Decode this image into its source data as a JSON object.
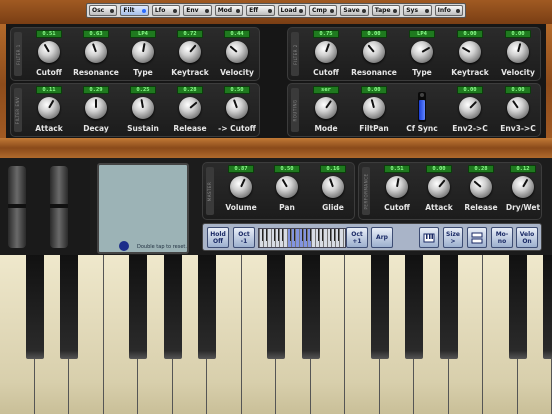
{
  "menu": [
    {
      "label": "Osc",
      "active": false
    },
    {
      "label": "Filt",
      "active": true
    },
    {
      "label": "Lfo",
      "active": false
    },
    {
      "label": "Env",
      "active": false
    },
    {
      "label": "Mod",
      "active": false
    },
    {
      "label": "Eff",
      "active": false
    },
    {
      "label": "Load",
      "active": false
    },
    {
      "label": "Cmp",
      "active": false
    },
    {
      "label": "Save",
      "active": false
    },
    {
      "label": "Tape",
      "active": false
    },
    {
      "label": "Sys",
      "active": false
    },
    {
      "label": "Info",
      "active": false
    }
  ],
  "filter1": {
    "label": "FILTER 1",
    "knobs": [
      {
        "name": "Cutoff",
        "value": "0.51"
      },
      {
        "name": "Resonance",
        "value": "0.63"
      },
      {
        "name": "Type",
        "value": "LP4"
      },
      {
        "name": "Keytrack",
        "value": "0.72"
      },
      {
        "name": "Velocity",
        "value": "0.44"
      }
    ]
  },
  "env1": {
    "label": "FILTER ENV",
    "knobs": [
      {
        "name": "Attack",
        "value": "0.11"
      },
      {
        "name": "Decay",
        "value": "0.29"
      },
      {
        "name": "Sustain",
        "value": "0.25"
      },
      {
        "name": "Release",
        "value": "0.28"
      },
      {
        "name": "-> Cutoff",
        "value": "0.50"
      }
    ]
  },
  "filter2": {
    "label": "FILTER 2",
    "knobs": [
      {
        "name": "Cutoff",
        "value": "0.75"
      },
      {
        "name": "Resonance",
        "value": "0.00"
      },
      {
        "name": "Type",
        "value": "LP4"
      },
      {
        "name": "Keytrack",
        "value": "0.00"
      },
      {
        "name": "Velocity",
        "value": "0.00"
      }
    ]
  },
  "routing": {
    "label": "ROUTING",
    "knobs": [
      {
        "name": "Mode",
        "value": "ser"
      },
      {
        "name": "FiltPan",
        "value": "0.00"
      },
      {
        "name": "Cf Sync",
        "value": ""
      },
      {
        "name": "Env2->C",
        "value": "0.00"
      },
      {
        "name": "Env3->C",
        "value": "0.00"
      }
    ]
  },
  "master": {
    "label": "MASTER",
    "knobs": [
      {
        "name": "Volume",
        "value": "0.87"
      },
      {
        "name": "Pan",
        "value": "0.50"
      },
      {
        "name": "Glide",
        "value": "0.16"
      }
    ]
  },
  "performance": {
    "label": "PERFORMANCE",
    "knobs": [
      {
        "name": "Cutoff",
        "value": "0.51"
      },
      {
        "name": "Attack",
        "value": "0.00"
      },
      {
        "name": "Release",
        "value": "0.28"
      },
      {
        "name": "Dry/Wet",
        "value": "0.12"
      }
    ]
  },
  "xy_pad": {
    "hint": "Double tap to reset."
  },
  "controls": [
    {
      "l1": "Hold",
      "l2": "Off"
    },
    {
      "l1": "Oct",
      "l2": "-1"
    },
    {
      "l1": "Oct",
      "l2": "+1"
    },
    {
      "l1": "Arp",
      "l2": ""
    },
    {
      "l1": "Size",
      "l2": ">"
    },
    {
      "l1": "Mo-",
      "l2": "no"
    },
    {
      "l1": "Velo",
      "l2": "On"
    }
  ]
}
